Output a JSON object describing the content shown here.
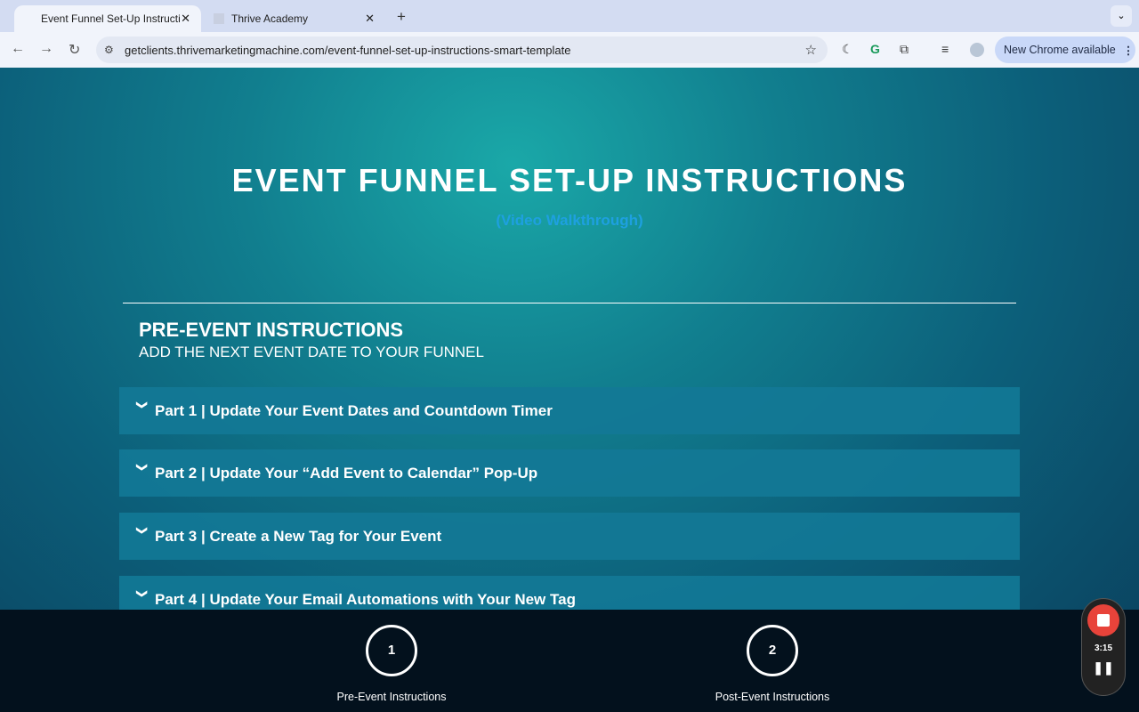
{
  "browser": {
    "tabs": [
      {
        "title": "Event Funnel Set-Up Instructi",
        "active": true
      },
      {
        "title": "Thrive Academy",
        "active": false
      }
    ],
    "url": "getclients.thrivemarketingmachine.com/event-funnel-set-up-instructions-smart-template",
    "update_label": "New Chrome available"
  },
  "page": {
    "title": "EVENT FUNNEL SET-UP INSTRUCTIONS",
    "subtitle": "(Video Walkthrough)",
    "section_title": "PRE-EVENT INSTRUCTIONS",
    "section_subtitle": "ADD THE NEXT EVENT DATE TO YOUR FUNNEL",
    "accordion": [
      {
        "label": "Part 1 | Update Your Event Dates and Countdown Timer"
      },
      {
        "label": "Part 2 | Update Your “Add Event to Calendar” Pop-Up"
      },
      {
        "label": "Part 3 | Create a New Tag for Your Event"
      },
      {
        "label": "Part 4 | Update Your Email Automations with Your New Tag"
      }
    ],
    "steps": [
      {
        "number": "1",
        "label": "Pre-Event Instructions"
      },
      {
        "number": "2",
        "label": "Post-Event Instructions"
      }
    ],
    "accent_color": "#1ea0e0"
  },
  "recorder": {
    "time": "3:15"
  }
}
